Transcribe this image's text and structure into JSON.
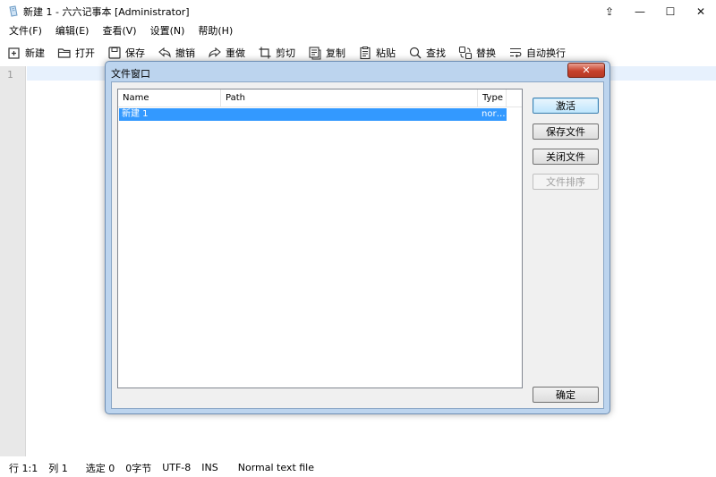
{
  "window": {
    "title": "新建 1 - 六六记事本 [Administrator]",
    "controls": {
      "pin": "⇪",
      "minimize": "—",
      "maximize": "☐",
      "close": "✕"
    }
  },
  "menu": [
    "文件(F)",
    "编辑(E)",
    "查看(V)",
    "设置(N)",
    "帮助(H)"
  ],
  "toolbar": [
    {
      "icon": "new-icon",
      "label": "新建"
    },
    {
      "icon": "open-icon",
      "label": "打开"
    },
    {
      "icon": "save-icon",
      "label": "保存"
    },
    {
      "icon": "undo-icon",
      "label": "撤销"
    },
    {
      "icon": "redo-icon",
      "label": "重做"
    },
    {
      "icon": "cut-icon",
      "label": "剪切"
    },
    {
      "icon": "copy-icon",
      "label": "复制"
    },
    {
      "icon": "paste-icon",
      "label": "粘贴"
    },
    {
      "icon": "find-icon",
      "label": "查找"
    },
    {
      "icon": "replace-icon",
      "label": "替换"
    },
    {
      "icon": "wrap-icon",
      "label": "自动换行"
    }
  ],
  "editor": {
    "line_number": "1"
  },
  "dialog": {
    "title": "文件窗口",
    "close": "✕",
    "columns": {
      "name": "Name",
      "path": "Path",
      "type": "Type"
    },
    "rows": [
      {
        "name": "新建 1",
        "path": "",
        "type": "nor…"
      }
    ],
    "buttons": {
      "activate": "激活",
      "save_file": "保存文件",
      "close_file": "关闭文件",
      "sort_files": "文件排序",
      "ok": "确定"
    }
  },
  "status": {
    "row": "行 1:1",
    "col": "列 1",
    "selected": "选定 0",
    "chars": "0字节",
    "encoding": "UTF-8",
    "mode": "INS",
    "filetype": "Normal text file"
  },
  "colors": {
    "selection": "#3399ff",
    "current_line": "#e7f1fd",
    "dialog_frame": "#bcd4ee"
  }
}
